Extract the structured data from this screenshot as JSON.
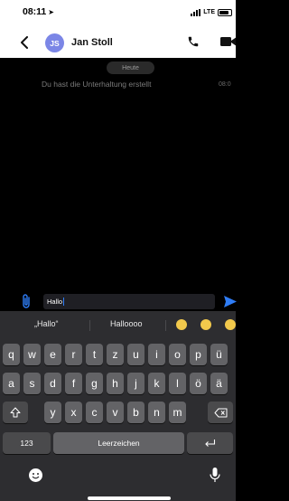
{
  "status_bar": {
    "time": "08:11",
    "network": "LTE",
    "battery_level": 0.85
  },
  "header": {
    "back_icon": "chevron-left-icon",
    "avatar_initials": "JS",
    "avatar_color": "#7b86e6",
    "contact_name": "Jan Stoll",
    "call_icon": "phone-icon",
    "video_icon": "video-camera-icon"
  },
  "chat": {
    "date_label": "Heute",
    "system_message": "Du hast die Unterhaltung erstellt",
    "system_time": "08:0"
  },
  "compose": {
    "attach_icon": "paperclip-icon",
    "input_value": "Hallo",
    "send_icon": "send-icon",
    "accent_color": "#2f7df6"
  },
  "keyboard": {
    "suggestions": [
      "„Hallo“",
      "Halloooo"
    ],
    "row1": [
      "q",
      "w",
      "e",
      "r",
      "t",
      "z",
      "u",
      "i",
      "o",
      "p",
      "ü"
    ],
    "row2": [
      "a",
      "s",
      "d",
      "f",
      "g",
      "h",
      "j",
      "k",
      "l",
      "ö",
      "ä"
    ],
    "row3": [
      "y",
      "x",
      "c",
      "v",
      "b",
      "n",
      "m"
    ],
    "shift_icon": "shift-icon",
    "delete_icon": "delete-icon",
    "numbers_label": "123",
    "space_label": "Leerzeichen",
    "return_icon": "return-icon",
    "emoji_icon": "emoji-icon",
    "mic_icon": "microphone-icon"
  }
}
